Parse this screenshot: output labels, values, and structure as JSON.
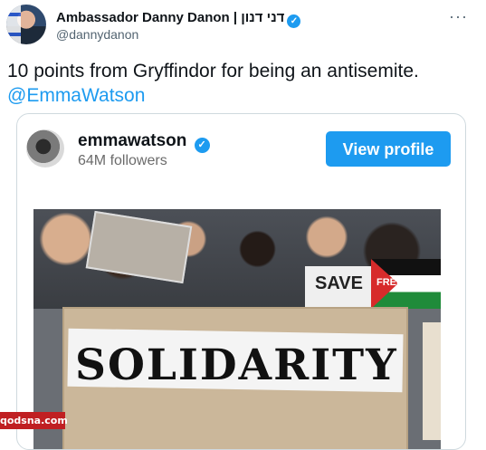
{
  "author": {
    "display_name": "Ambassador Danny Danon | דני דנון",
    "handle": "@dannydanon"
  },
  "tweet": {
    "text": "10 points from Gryffindor for being an antisemite.",
    "mention": "@EmmaWatson"
  },
  "embed": {
    "username": "emmawatson",
    "followers": "64M followers",
    "button_label": "View profile",
    "signs": {
      "main": "SOLIDARITY",
      "save": "SAVE",
      "free": "FREE"
    }
  },
  "watermark": "qodsna.com",
  "icons": {
    "verified": "verified-badge-icon",
    "more": "more-options-icon"
  },
  "colors": {
    "accent": "#1d9bf0",
    "text": "#0f1419",
    "secondary_text": "#536471"
  }
}
